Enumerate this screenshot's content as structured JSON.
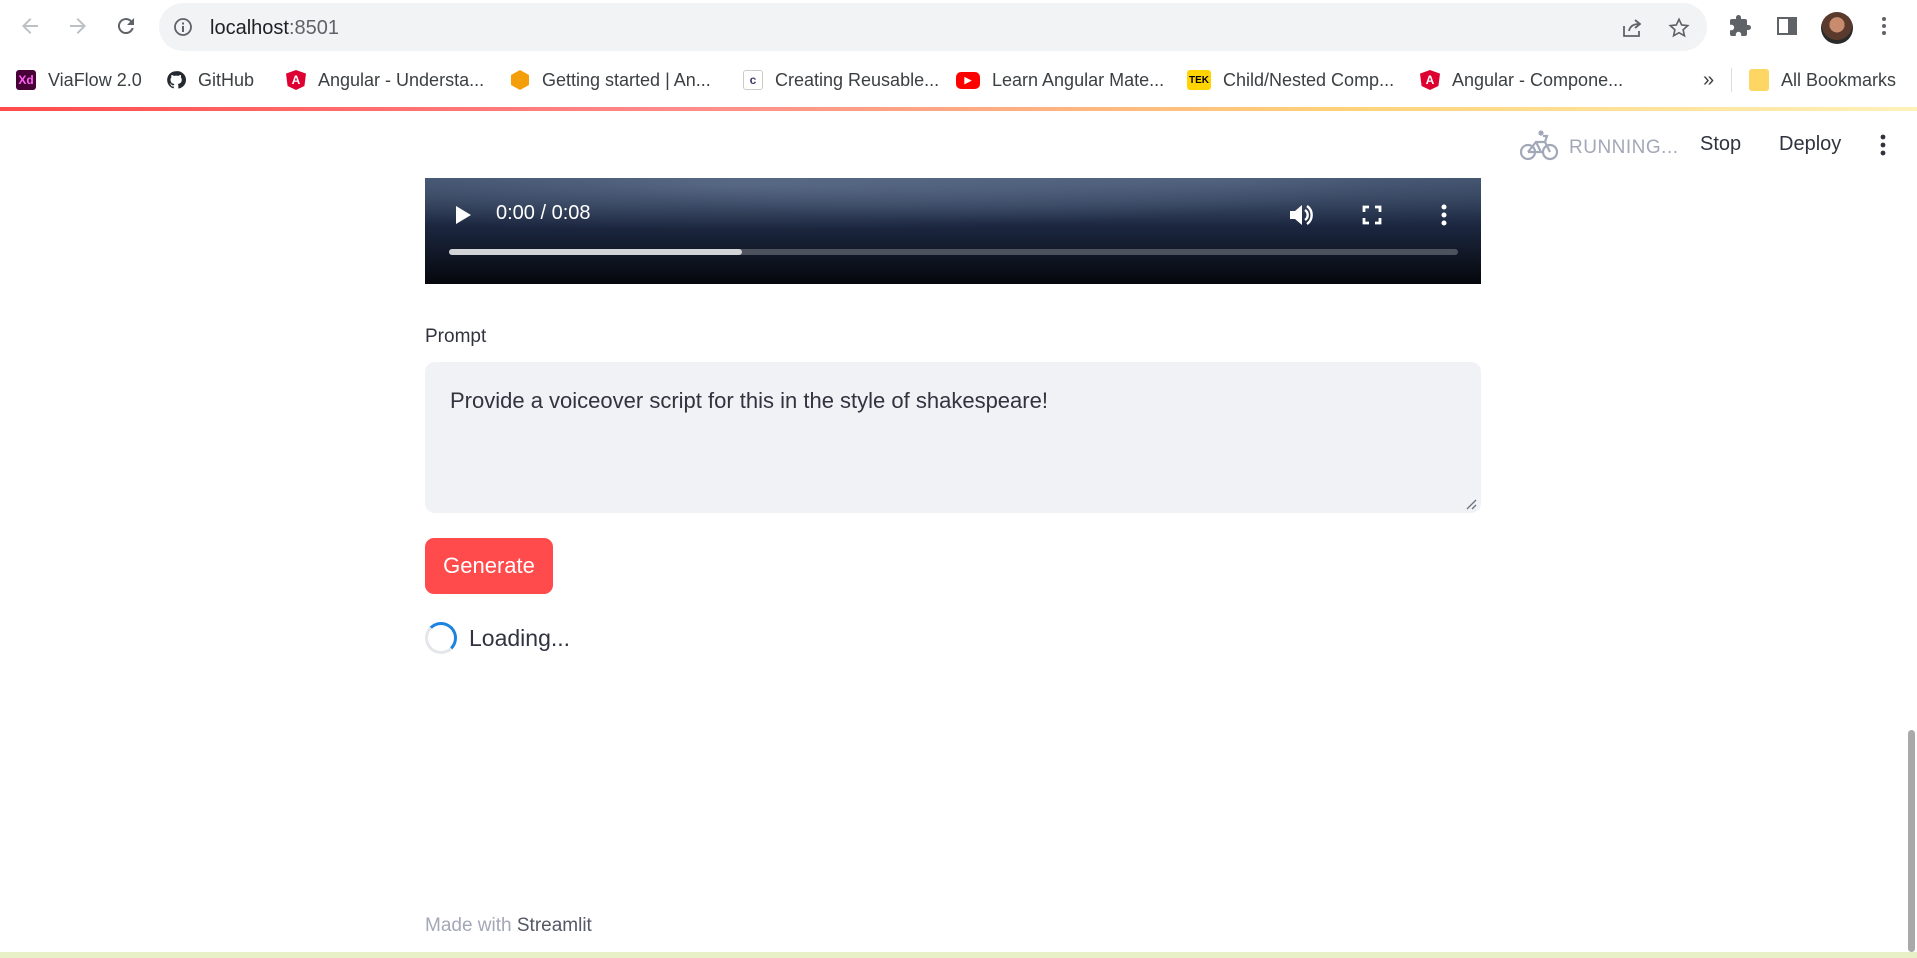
{
  "browser": {
    "url_host": "localhost",
    "url_port": ":8501",
    "bookmarks": [
      {
        "label": "ViaFlow 2.0",
        "icon": "xd-icon",
        "color": "#470137",
        "glyph": "Xd"
      },
      {
        "label": "GitHub",
        "icon": "github-icon",
        "color": "#24292f",
        "glyph": ""
      },
      {
        "label": "Angular - Understa...",
        "icon": "angular-icon",
        "color": "#dd0031",
        "glyph": "A"
      },
      {
        "label": "Getting started | An...",
        "icon": "hexagon-icon",
        "color": "#f59e0b",
        "glyph": ""
      },
      {
        "label": "Creating Reusable...",
        "icon": "c-icon",
        "color": "#3b3b6d",
        "glyph": "c"
      },
      {
        "label": "Learn Angular Mate...",
        "icon": "youtube-icon",
        "color": "#ff0000",
        "glyph": "▶"
      },
      {
        "label": "Child/Nested Comp...",
        "icon": "tek-icon",
        "color": "#ffd400",
        "glyph": "TEK"
      },
      {
        "label": "Angular - Compone...",
        "icon": "angular-icon",
        "color": "#dd0031",
        "glyph": "A"
      }
    ],
    "overflow": "»",
    "all_bookmarks": "All Bookmarks"
  },
  "header": {
    "status": "RUNNING...",
    "stop": "Stop",
    "deploy": "Deploy"
  },
  "video": {
    "time": "0:00 / 0:08",
    "progress_fraction": 0.29
  },
  "prompt": {
    "label": "Prompt",
    "value": "Provide a voiceover script for this in the style of shakespeare!"
  },
  "generate": "Generate",
  "loading": "Loading...",
  "footer": {
    "prefix": "Made with ",
    "brand": "Streamlit"
  },
  "colors": {
    "primary": "#ff4b4b",
    "spinner": "#1c83e1"
  }
}
